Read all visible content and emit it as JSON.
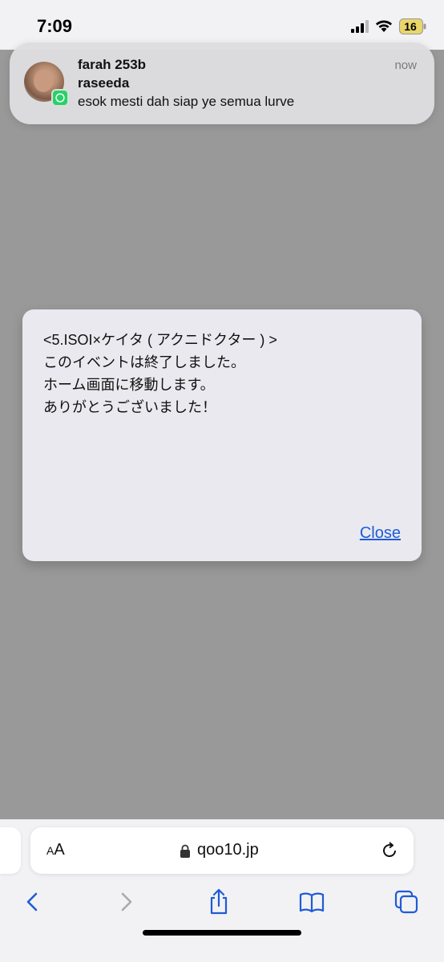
{
  "status_bar": {
    "time": "7:09",
    "battery": "16",
    "icons": [
      "signal-icon",
      "wifi-icon",
      "battery-icon"
    ]
  },
  "notification": {
    "sender": "farah 253b",
    "group": "raseeda",
    "message": "esok mesti dah siap ye semua lurve",
    "time": "now",
    "app_icon": "whatsapp-icon"
  },
  "alert": {
    "lines": [
      "<5.ISOI×ケイタ ( アクニドクター ) >",
      "このイベントは終了しました。",
      "ホーム画面に移動します。",
      "ありがとうございました！"
    ],
    "close_label": "Close",
    "accent_color": "#1f5bd6"
  },
  "browser": {
    "aa_label_small": "A",
    "aa_label_large": "A",
    "url": "qoo10.jp",
    "toolbar_icons": [
      "back-icon",
      "forward-icon",
      "share-icon",
      "bookmarks-icon",
      "tabs-icon"
    ],
    "tint_color": "#1f5bd6"
  }
}
